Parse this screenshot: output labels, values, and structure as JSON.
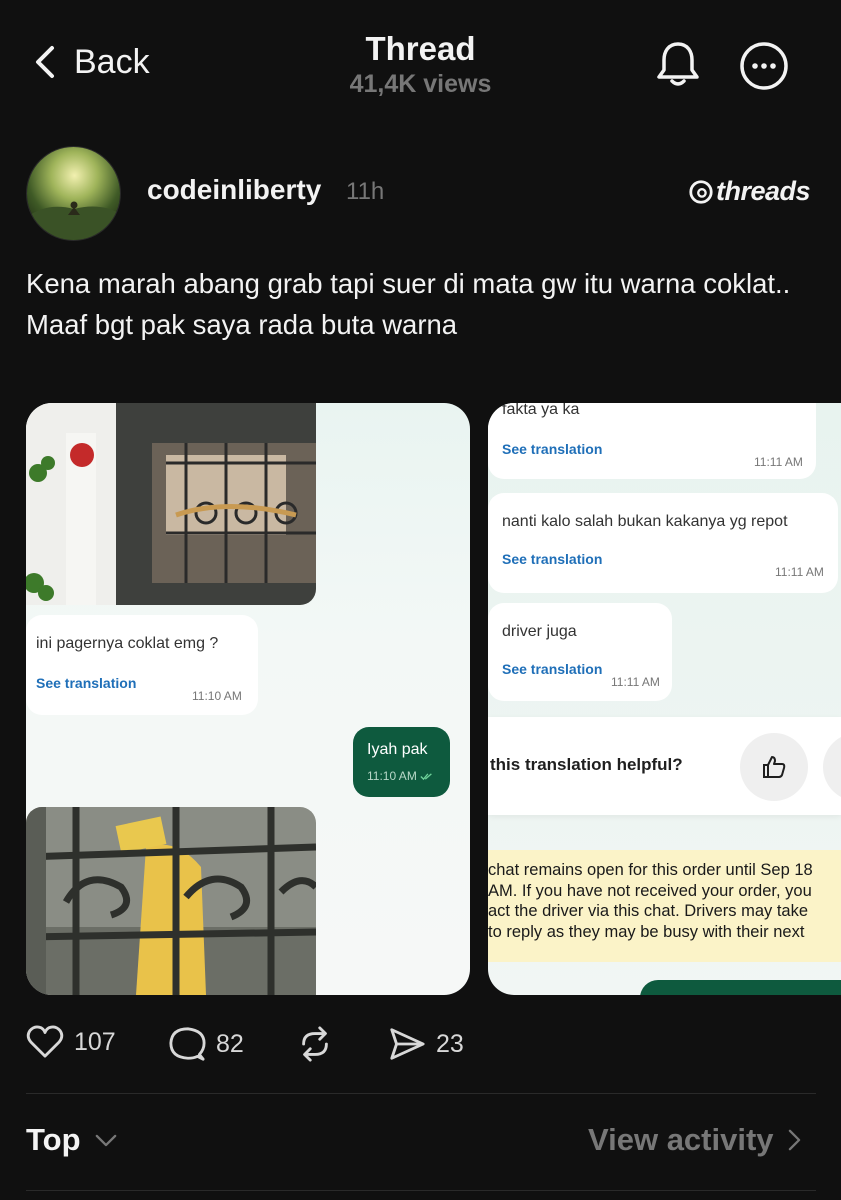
{
  "header": {
    "back_label": "Back",
    "title": "Thread",
    "views": "41,4K views"
  },
  "post": {
    "username": "codeinliberty",
    "time": "11h",
    "platform_label": "threads",
    "text_line1": "Kena marah abang grab tapi suer di mata gw itu warna coklat..",
    "text_line2": "Maaf bgt pak saya rada buta warna"
  },
  "screenshot1": {
    "msg1": "ini pagernya coklat emg ?",
    "msg1_see": "See translation",
    "msg1_time": "11:10 AM",
    "reply": "Iyah pak",
    "reply_time": "11:10 AM"
  },
  "screenshot2": {
    "msg0": "fakta ya ka",
    "msg0_see": "See translation",
    "msg0_time": "11:11 AM",
    "msg1": "nanti kalo salah bukan kakanya yg repot",
    "msg1_see": "See translation",
    "msg1_time": "11:11 AM",
    "msg2": "driver juga",
    "msg2_see": "See translation",
    "msg2_time": "11:11 AM",
    "helpful_question": "this translation helpful?",
    "notice_line1": "chat remains open for this order until Sep 18",
    "notice_line2": "AM. If you have not received your order, you",
    "notice_line3": "act the driver via this chat. Drivers may take",
    "notice_line4": "to reply as they may be busy with their next"
  },
  "actions": {
    "likes": "107",
    "replies": "82",
    "shares": "23"
  },
  "footer": {
    "sort_label": "Top",
    "activity_label": "View activity"
  },
  "colors": {
    "background": "#101010",
    "muted": "#777777",
    "link_blue": "#1f6fb8",
    "chat_green": "#0e5a3e",
    "notice_yellow": "#fbf3c8"
  },
  "icons": [
    "chevron-left-icon",
    "bell-icon",
    "more-icon",
    "threads-logo-icon",
    "heart-icon",
    "comment-icon",
    "repost-icon",
    "send-icon",
    "chevron-down-icon",
    "chevron-right-icon",
    "thumbs-up-icon",
    "double-check-icon"
  ]
}
